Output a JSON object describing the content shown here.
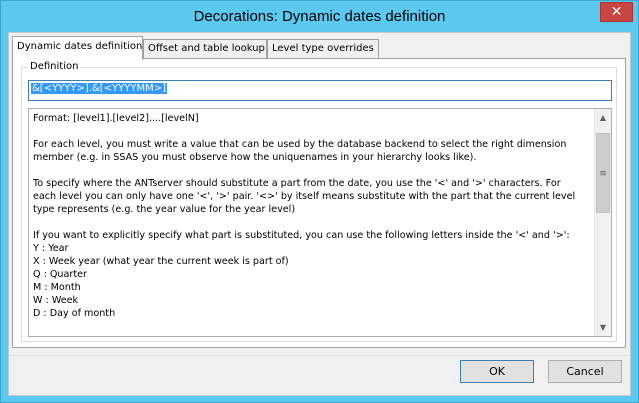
{
  "window": {
    "title": "Decorations: Dynamic dates definition",
    "close_label": "✕"
  },
  "tabs": [
    {
      "label": "Dynamic dates definition",
      "active": true
    },
    {
      "label": "Offset and table lookup",
      "active": false
    },
    {
      "label": "Level type overrides",
      "active": false
    }
  ],
  "definition": {
    "group_label": "Definition",
    "value": "&[<YYYY>].&[<YYYYMM>]"
  },
  "help": {
    "lines": [
      "Format: [level1].[level2]....[levelN]",
      "",
      "For each level, you must write a value that can be used by the database backend to select the right dimension",
      "member (e.g. in SSAS you must observe how the uniquenames in your hierarchy looks like).",
      "",
      "To specify where the ANTserver should substitute a part from the date, you use the '<' and '>' characters. For",
      "each level you can only have one '<', '>' pair. '<>' by itself means substitute with the part that the current level",
      "type represents (e.g. the year value for the year level)",
      "",
      "If you want to explicitly specify what part is substituted, you can use the following letters inside the '<' and '>':",
      "Y : Year",
      "X : Week year (what year the current week is part of)",
      "Q : Quarter",
      "M : Month",
      "W : Week",
      "D : Day of month"
    ]
  },
  "buttons": {
    "ok": "OK",
    "cancel": "Cancel"
  }
}
